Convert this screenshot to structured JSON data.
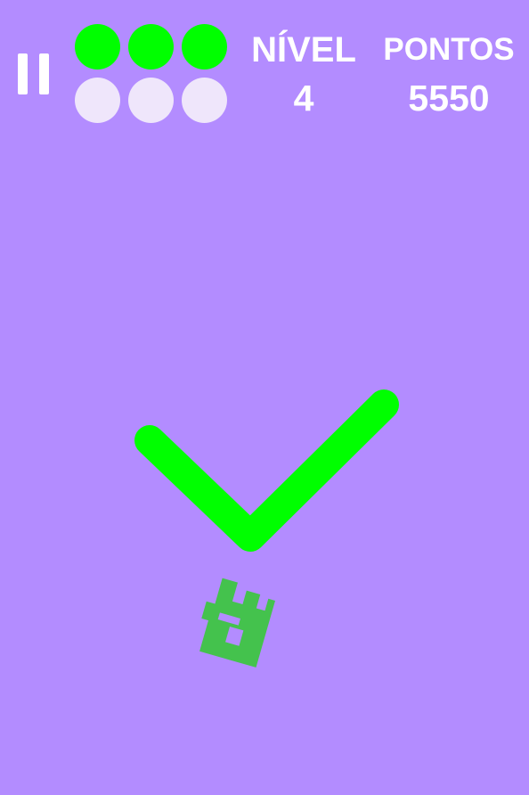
{
  "hud": {
    "level_label": "NÍVEL",
    "level_value": "4",
    "score_label": "PONTOS",
    "score_value": "5550"
  },
  "lives": {
    "filled_color": "#00ff00",
    "empty_color": "#efe6fb",
    "slots": [
      {
        "state": "filled"
      },
      {
        "state": "filled"
      },
      {
        "state": "filled"
      },
      {
        "state": "empty"
      },
      {
        "state": "empty"
      },
      {
        "state": "empty"
      }
    ]
  },
  "colors": {
    "background": "#b38cff",
    "check": "#00ff00",
    "character": "#44c24d",
    "text": "#ffffff"
  },
  "icons": {
    "pause": "pause-icon",
    "feedback": "checkmark-icon",
    "player": "block-character-icon"
  }
}
